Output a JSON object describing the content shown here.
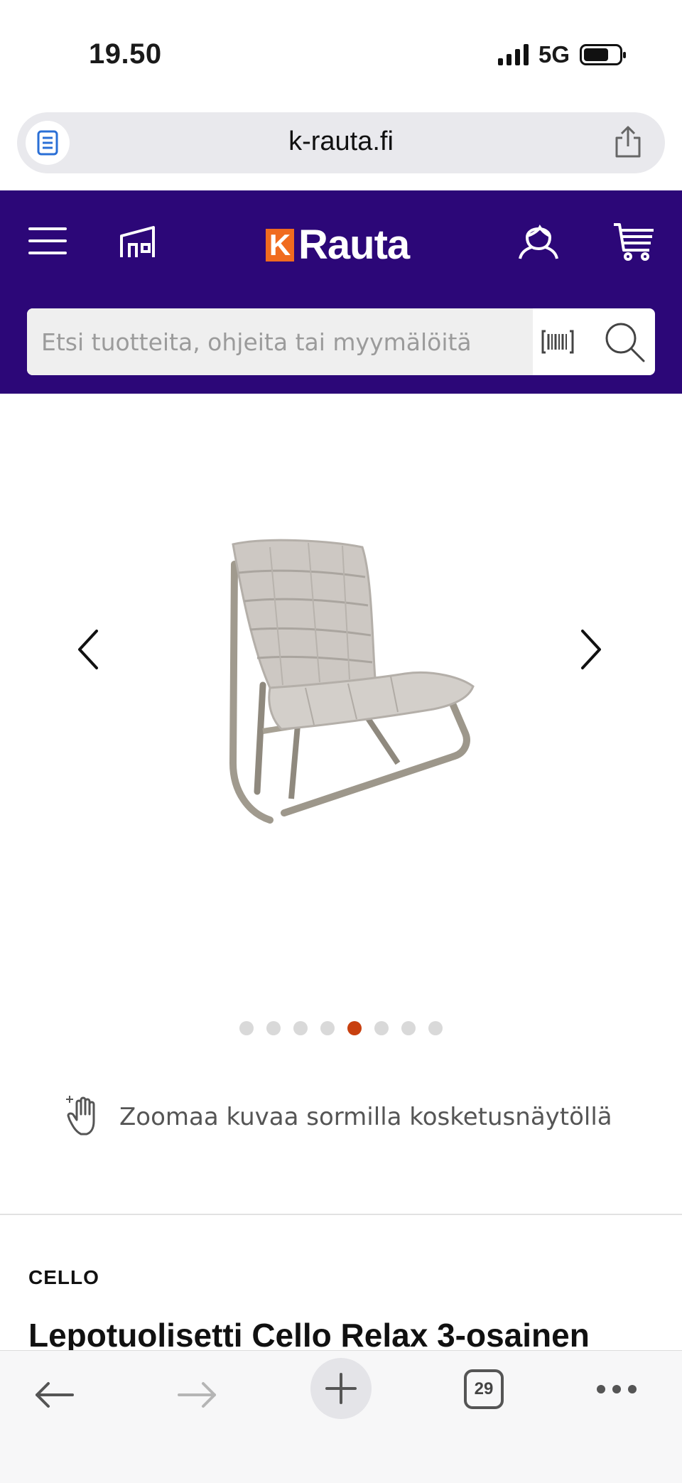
{
  "status": {
    "time": "19.50",
    "network": "5G"
  },
  "browser": {
    "url": "k-rauta.fi",
    "tab_count": "29"
  },
  "header": {
    "logo_k": "K",
    "logo_text": "Rauta",
    "search_placeholder": "Etsi tuotteita, ohjeita tai myymälöitä",
    "background": "#2c0778",
    "accent": "#f06b1f"
  },
  "gallery": {
    "image_count": 8,
    "active_index": 4,
    "dots": [
      "1",
      "2",
      "3",
      "4",
      "5",
      "6",
      "7",
      "8"
    ],
    "zoom_hint": "Zoomaa kuvaa sormilla kosketusnäytöllä"
  },
  "product": {
    "brand": "CELLO",
    "title": "Lepotuolisetti Cello Relax 3-osainen"
  },
  "icons": {
    "menu": "menu-icon",
    "store": "store-icon",
    "account": "account-icon",
    "cart": "cart-icon",
    "barcode": "barcode-icon",
    "search": "search-icon",
    "prev": "chevron-left-icon",
    "next": "chevron-right-icon",
    "touch": "touch-zoom-icon"
  }
}
